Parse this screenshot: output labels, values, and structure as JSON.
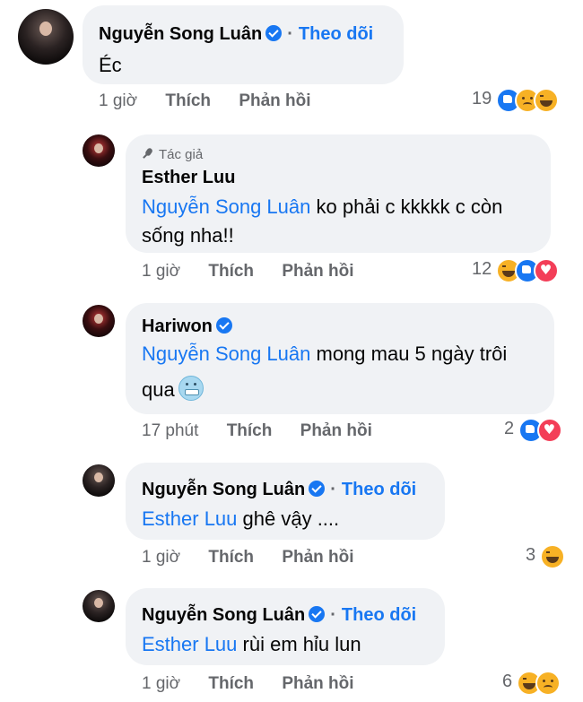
{
  "comments": [
    {
      "author": "Nguyễn Song Luân",
      "verified": true,
      "follow_label": "Theo dõi",
      "text": "Éc",
      "time": "1 giờ",
      "like_label": "Thích",
      "reply_label": "Phản hồi",
      "reaction_count": "19",
      "reactions": [
        "like-icon",
        "sad-icon",
        "haha-icon"
      ]
    },
    {
      "author_tag": "Tác giả",
      "author": "Esther Luu",
      "verified": false,
      "mention": "Nguyễn Song Luân",
      "text_line1": "ko phải c kkkkk c còn",
      "text_line2": "sống nha!!",
      "time": "1 giờ",
      "like_label": "Thích",
      "reply_label": "Phản hồi",
      "reaction_count": "12",
      "reactions": [
        "haha-icon",
        "like-icon",
        "love-icon"
      ]
    },
    {
      "author": "Hariwon",
      "verified": true,
      "mention": "Nguyễn Song Luân",
      "text_line1": "mong mau 5 ngày trôi",
      "text_line2": "qua",
      "emoji": "cold-face-icon",
      "time": "17 phút",
      "like_label": "Thích",
      "reply_label": "Phản hồi",
      "reaction_count": "2",
      "reactions": [
        "like-icon",
        "love-icon"
      ]
    },
    {
      "author": "Nguyễn Song Luân",
      "verified": true,
      "follow_label": "Theo dõi",
      "mention": "Esther Luu",
      "text": "ghê vậy ....",
      "time": "1 giờ",
      "like_label": "Thích",
      "reply_label": "Phản hồi",
      "reaction_count": "3",
      "reactions": [
        "haha-icon"
      ]
    },
    {
      "author": "Nguyễn Song Luân",
      "verified": true,
      "follow_label": "Theo dõi",
      "mention": "Esther Luu",
      "text": "rùi em hỉu lun",
      "time": "1 giờ",
      "like_label": "Thích",
      "reply_label": "Phản hồi",
      "reaction_count": "6",
      "reactions": [
        "haha-icon",
        "sad-icon"
      ]
    }
  ],
  "colors": {
    "accent": "#1877f2",
    "bubble": "#f0f2f5",
    "meta": "#65676b"
  }
}
